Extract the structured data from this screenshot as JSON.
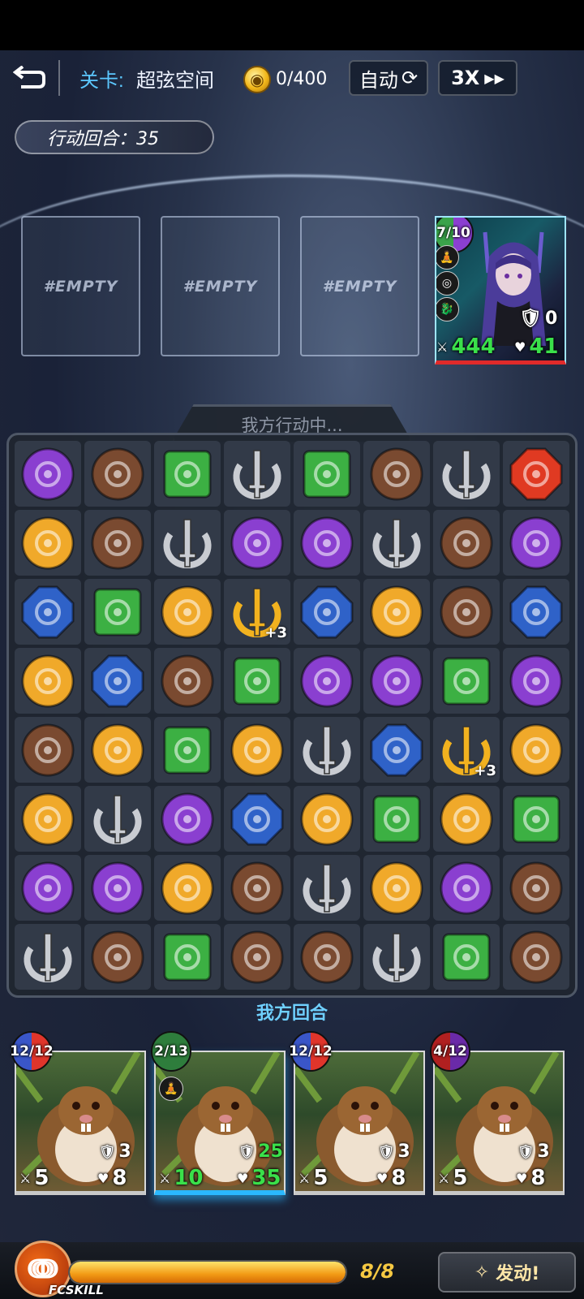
{
  "topbar": {
    "back_icon": "back-arrow-icon",
    "level_label": "关卡:",
    "level_name": "超弦空间",
    "coin_value": "0/400",
    "auto_label": "自动",
    "speed_label": "3X",
    "menu_icon": "grid-menu-icon"
  },
  "round": {
    "label": "行动回合：35"
  },
  "enemy_slots": {
    "empty_label": "#EMPTY"
  },
  "enemy": {
    "cost": "7/10",
    "shield": "0",
    "attack": "444",
    "health": "41",
    "cost_colors": [
      "#8b3fd1",
      "#3aa34a"
    ]
  },
  "board": {
    "status": "我方行动中...",
    "turn_label": "我方回合",
    "rows": [
      [
        "purple",
        "brown",
        "green",
        "silver",
        "green",
        "brown",
        "silver",
        "red"
      ],
      [
        "gold",
        "brown",
        "silver",
        "purple",
        "purple",
        "silver",
        "brown",
        "purple"
      ],
      [
        "blue",
        "green",
        "gold",
        "goldsword+3",
        "blue",
        "gold",
        "brown",
        "blue"
      ],
      [
        "gold",
        "blue",
        "brown",
        "green",
        "purple",
        "purple",
        "green",
        "purple"
      ],
      [
        "brown",
        "gold",
        "green",
        "gold",
        "silver",
        "blue",
        "goldsword+3",
        "gold"
      ],
      [
        "gold",
        "silver",
        "purple",
        "blue",
        "gold",
        "green",
        "gold",
        "green"
      ],
      [
        "purple",
        "purple",
        "gold",
        "brown",
        "silver",
        "gold",
        "purple",
        "brown"
      ],
      [
        "silver",
        "brown",
        "green",
        "brown",
        "brown",
        "silver",
        "green",
        "brown"
      ]
    ],
    "colors": {
      "purple": "#8a3fd0",
      "brown": "#7a4a30",
      "green": "#3cb043",
      "silver": "#c9ccd2",
      "gold": "#f0a92a",
      "blue": "#2f62c8",
      "red": "#e03a22"
    }
  },
  "hand": [
    {
      "cost": "12/12",
      "shield": "3",
      "attack": "5",
      "health": "8",
      "colors": [
        "#e0352b",
        "#3a56c8"
      ],
      "selected": false
    },
    {
      "cost": "2/13",
      "shield": "25",
      "attack": "10",
      "health": "35",
      "colors": [
        "#2e7d3c",
        "#2e7d3c"
      ],
      "selected": true
    },
    {
      "cost": "12/12",
      "shield": "3",
      "attack": "5",
      "health": "8",
      "colors": [
        "#e0352b",
        "#3a56c8"
      ],
      "selected": false
    },
    {
      "cost": "4/12",
      "shield": "3",
      "attack": "5",
      "health": "8",
      "colors": [
        "#6a2aa8",
        "#b02020"
      ],
      "selected": false
    }
  ],
  "footer": {
    "fcskill_label": "FCSKILL",
    "energy_text": "8/8",
    "energy_fraction": 1.0,
    "launch_label": "发动!"
  }
}
